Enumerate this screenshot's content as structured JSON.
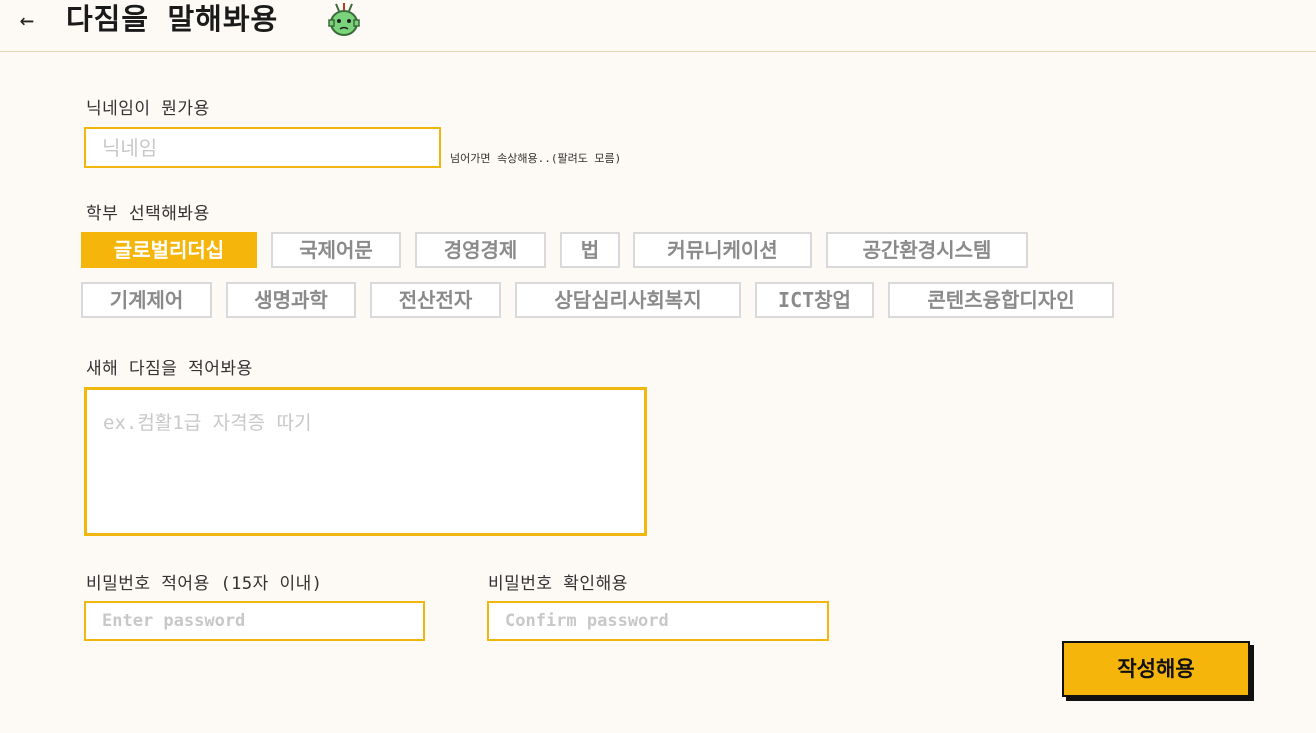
{
  "header": {
    "title": "다짐을 말해봐용"
  },
  "nickname": {
    "label": "닉네임이 뭔가용",
    "placeholder": "닉네임",
    "hint": "넘어가면 속상해용..(팔려도 모름)"
  },
  "department": {
    "label": "학부 선택해봐용",
    "options": [
      "글로벌리더십",
      "국제어문",
      "경영경제",
      "법",
      "커뮤니케이션",
      "공간환경시스템",
      "기계제어",
      "생명과학",
      "전산전자",
      "상담심리사회복지",
      "ICT창업",
      "콘텐츠융합디자인"
    ],
    "selected": "글로벌리더십"
  },
  "resolution": {
    "label": "새해 다짐을 적어봐용",
    "placeholder": "ex.컴활1급 자격증 따기"
  },
  "password": {
    "label": "비밀번호 적어용 (15자 이내)",
    "placeholder": "Enter password"
  },
  "confirm": {
    "label": "비밀번호 확인해용",
    "placeholder": "Confirm password"
  },
  "submit": {
    "label": "작성해용"
  },
  "colors": {
    "accent": "#f5b50a",
    "mascot": "#7bd47b"
  }
}
